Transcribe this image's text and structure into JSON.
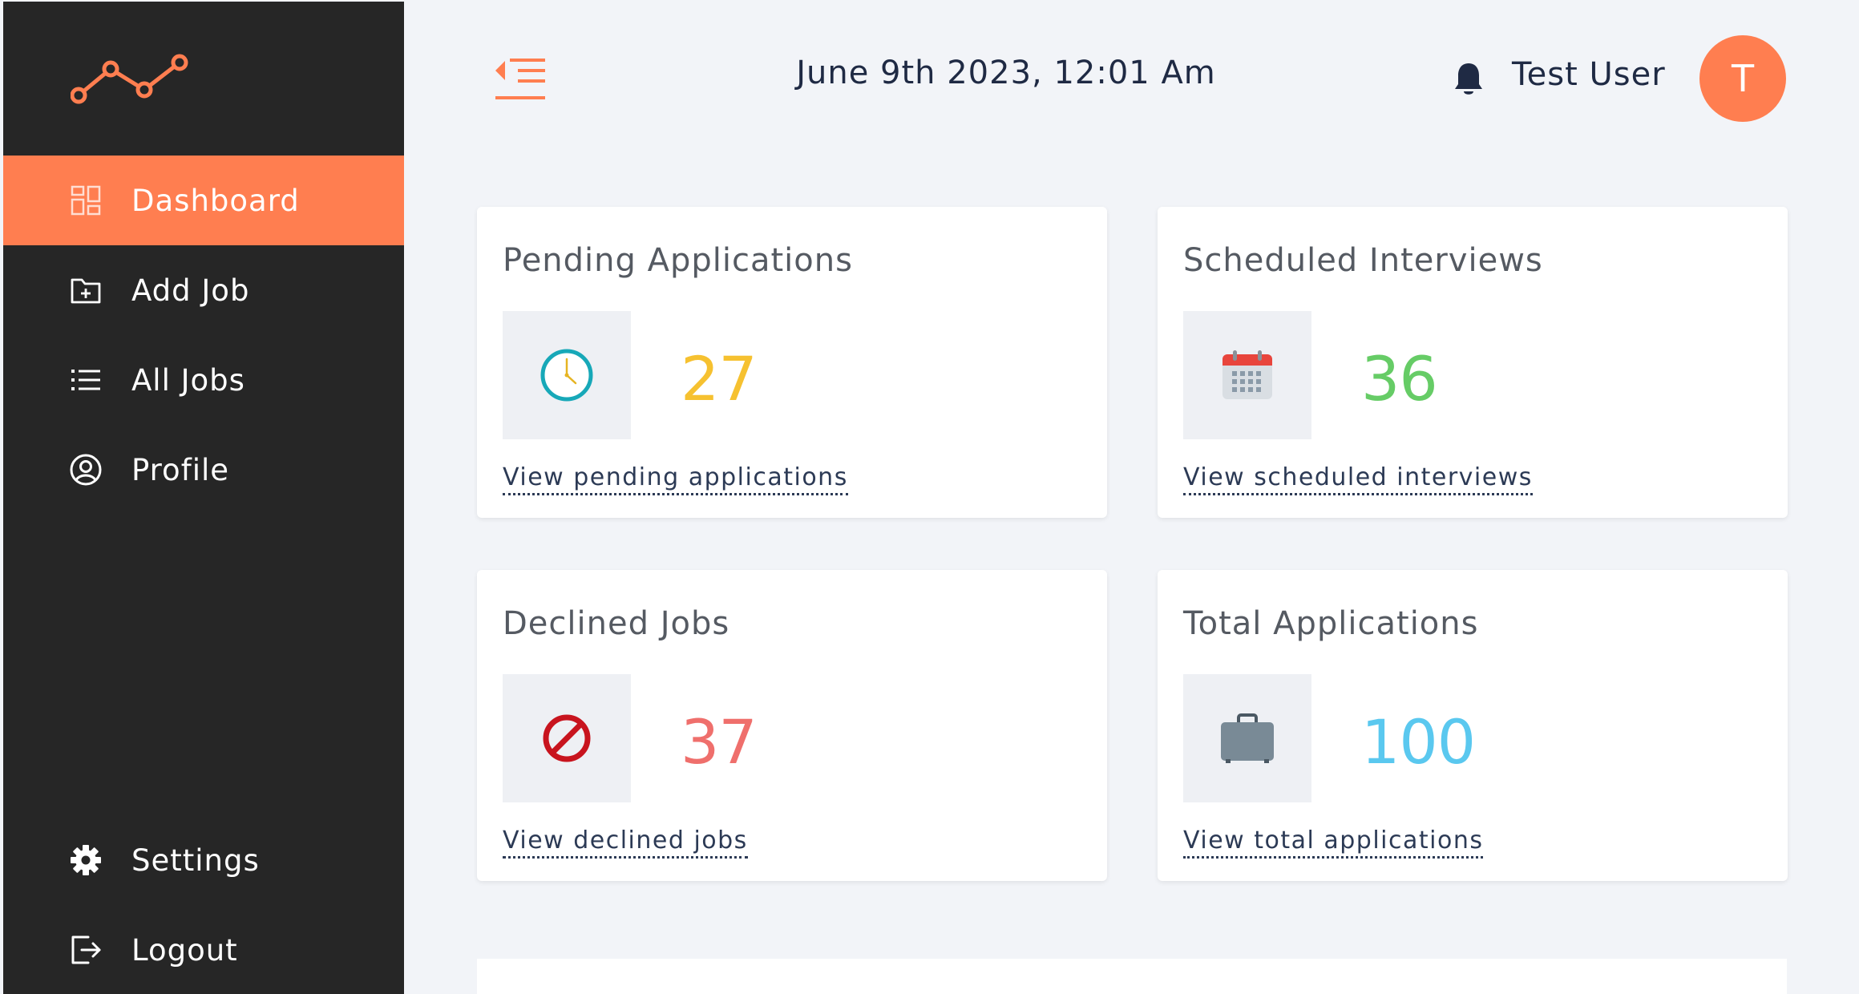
{
  "sidebar": {
    "items": [
      {
        "label": "Dashboard",
        "icon": "dashboard-icon",
        "active": true
      },
      {
        "label": "Add Job",
        "icon": "folder-add-icon",
        "active": false
      },
      {
        "label": "All Jobs",
        "icon": "list-icon",
        "active": false
      },
      {
        "label": "Profile",
        "icon": "user-circle-icon",
        "active": false
      }
    ],
    "bottom_items": [
      {
        "label": "Settings",
        "icon": "gear-icon"
      },
      {
        "label": "Logout",
        "icon": "logout-icon"
      }
    ]
  },
  "header": {
    "datetime": "June 9th 2023, 12:01 Am",
    "user_name": "Test User",
    "avatar_initial": "T"
  },
  "stats": [
    {
      "title": "Pending Applications",
      "value": "27",
      "link": "View pending applications",
      "icon": "clock-icon",
      "color": "#f6c130"
    },
    {
      "title": "Scheduled Interviews",
      "value": "36",
      "link": "View scheduled interviews",
      "icon": "calendar-icon",
      "color": "#66cc66"
    },
    {
      "title": "Declined Jobs",
      "value": "37",
      "link": "View declined jobs",
      "icon": "prohibited-icon",
      "color": "#ef6f6c"
    },
    {
      "title": "Total Applications",
      "value": "100",
      "link": "View total applications",
      "icon": "briefcase-icon",
      "color": "#5ac8ef"
    }
  ],
  "colors": {
    "accent": "#ff7e50",
    "sidebar_bg": "#262626",
    "page_bg": "#f2f4f8"
  }
}
